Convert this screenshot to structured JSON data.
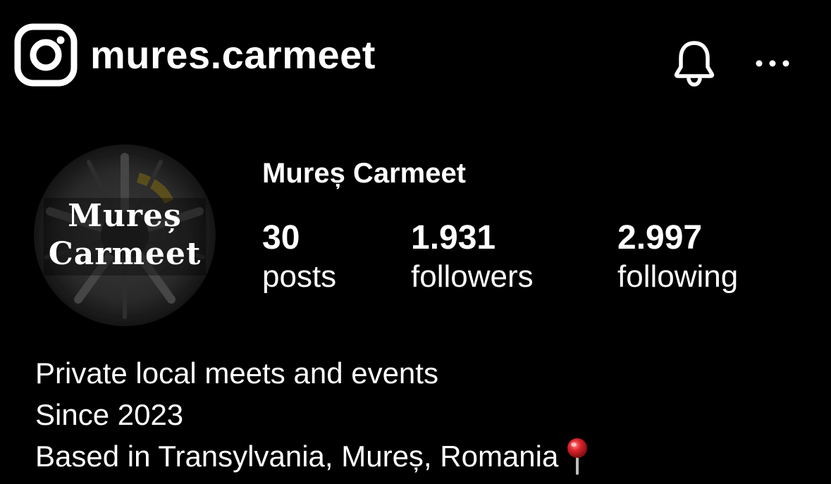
{
  "header": {
    "logo_icon": "instagram-logo-icon",
    "username": "mures.carmeet",
    "actions": [
      {
        "icon": "bell-icon"
      },
      {
        "icon": "more-horizontal-icon"
      }
    ]
  },
  "profile": {
    "avatar_text_line1": "Mureș",
    "avatar_text_line2": "Carmeet",
    "display_name": "Mureș Carmeet",
    "stats": {
      "posts": {
        "value": "30",
        "label": "posts"
      },
      "followers": {
        "value": "1.931",
        "label": "followers"
      },
      "following": {
        "value": "2.997",
        "label": "following"
      }
    },
    "bio": {
      "line1": "Private local meets and events",
      "line2": "Since 2023",
      "line3": "Based in Transylvania, Mureș, Romania",
      "line3_icon": "round-pushpin-icon"
    }
  },
  "colors": {
    "background": "#000000",
    "text": "#ffffff",
    "pin_red": "#e0282e"
  }
}
